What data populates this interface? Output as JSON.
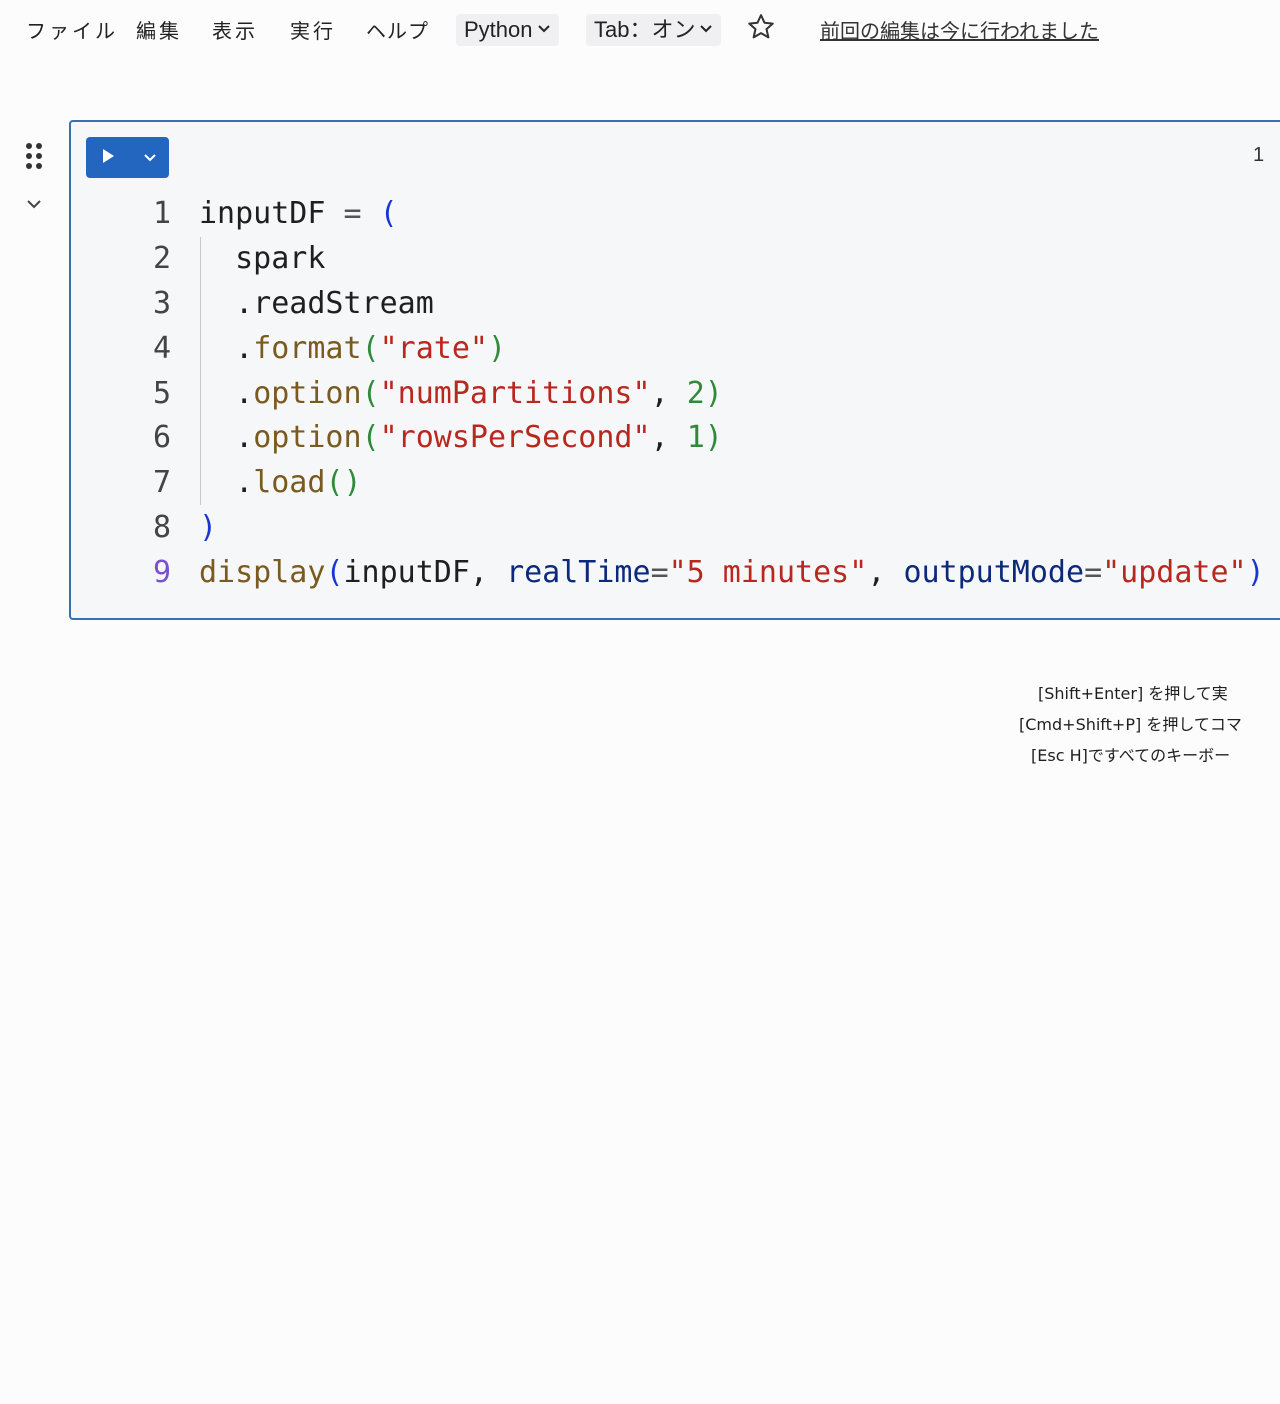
{
  "menu": {
    "file": "ファイル",
    "edit": "編集",
    "view": "表示",
    "run": "実行",
    "help": "ヘルプ"
  },
  "language_pill": "Python",
  "tab_pill": "Tab：オン",
  "last_edit": "前回の編集は今に行われました",
  "icons": {
    "star": "star-icon",
    "drag": "drag-handle-icon",
    "collapse": "chevron-down-icon",
    "run": "play-icon",
    "run_menu": "chevron-down-icon"
  },
  "colors": {
    "accent": "#2266c0",
    "cell_border": "#3a6fb0",
    "cell_bg": "#f6f7f9"
  },
  "cell": {
    "number": "1",
    "lines": [
      {
        "n": "1",
        "tokens": [
          {
            "t": "inputDF ",
            "c": "id"
          },
          {
            "t": "= ",
            "c": "op"
          },
          {
            "t": "(",
            "c": "paren1"
          }
        ]
      },
      {
        "n": "2",
        "tokens": [
          {
            "t": "  spark",
            "c": "id"
          }
        ]
      },
      {
        "n": "3",
        "tokens": [
          {
            "t": "  .readStream",
            "c": "id"
          }
        ]
      },
      {
        "n": "4",
        "tokens": [
          {
            "t": "  .",
            "c": "id"
          },
          {
            "t": "format",
            "c": "fn"
          },
          {
            "t": "(",
            "c": "paren2"
          },
          {
            "t": "\"rate\"",
            "c": "str"
          },
          {
            "t": ")",
            "c": "paren2"
          }
        ]
      },
      {
        "n": "5",
        "tokens": [
          {
            "t": "  .",
            "c": "id"
          },
          {
            "t": "option",
            "c": "fn"
          },
          {
            "t": "(",
            "c": "paren2"
          },
          {
            "t": "\"numPartitions\"",
            "c": "str"
          },
          {
            "t": ", ",
            "c": "id"
          },
          {
            "t": "2",
            "c": "num"
          },
          {
            "t": ")",
            "c": "paren2"
          }
        ]
      },
      {
        "n": "6",
        "tokens": [
          {
            "t": "  .",
            "c": "id"
          },
          {
            "t": "option",
            "c": "fn"
          },
          {
            "t": "(",
            "c": "paren2"
          },
          {
            "t": "\"rowsPerSecond\"",
            "c": "str"
          },
          {
            "t": ", ",
            "c": "id"
          },
          {
            "t": "1",
            "c": "num"
          },
          {
            "t": ")",
            "c": "paren2"
          }
        ]
      },
      {
        "n": "7",
        "tokens": [
          {
            "t": "  .",
            "c": "id"
          },
          {
            "t": "load",
            "c": "fn"
          },
          {
            "t": "()",
            "c": "paren2"
          }
        ]
      },
      {
        "n": "8",
        "tokens": [
          {
            "t": ")",
            "c": "paren1"
          }
        ]
      },
      {
        "n": "9",
        "active": true,
        "tokens": [
          {
            "t": "display",
            "c": "fn"
          },
          {
            "t": "(",
            "c": "paren1"
          },
          {
            "t": "inputDF, ",
            "c": "id"
          },
          {
            "t": "realTime",
            "c": "kw"
          },
          {
            "t": "=",
            "c": "op"
          },
          {
            "t": "\"5 minutes\"",
            "c": "str"
          },
          {
            "t": ", ",
            "c": "id"
          },
          {
            "t": "outputMode",
            "c": "kw"
          },
          {
            "t": "=",
            "c": "op"
          },
          {
            "t": "\"update\"",
            "c": "str"
          },
          {
            "t": ")",
            "c": "paren1"
          }
        ]
      }
    ]
  },
  "hints": [
    "[Shift+Enter] を押して実",
    "[Cmd+Shift+P] を押してコマ",
    "[Esc H]ですべてのキーボー"
  ]
}
